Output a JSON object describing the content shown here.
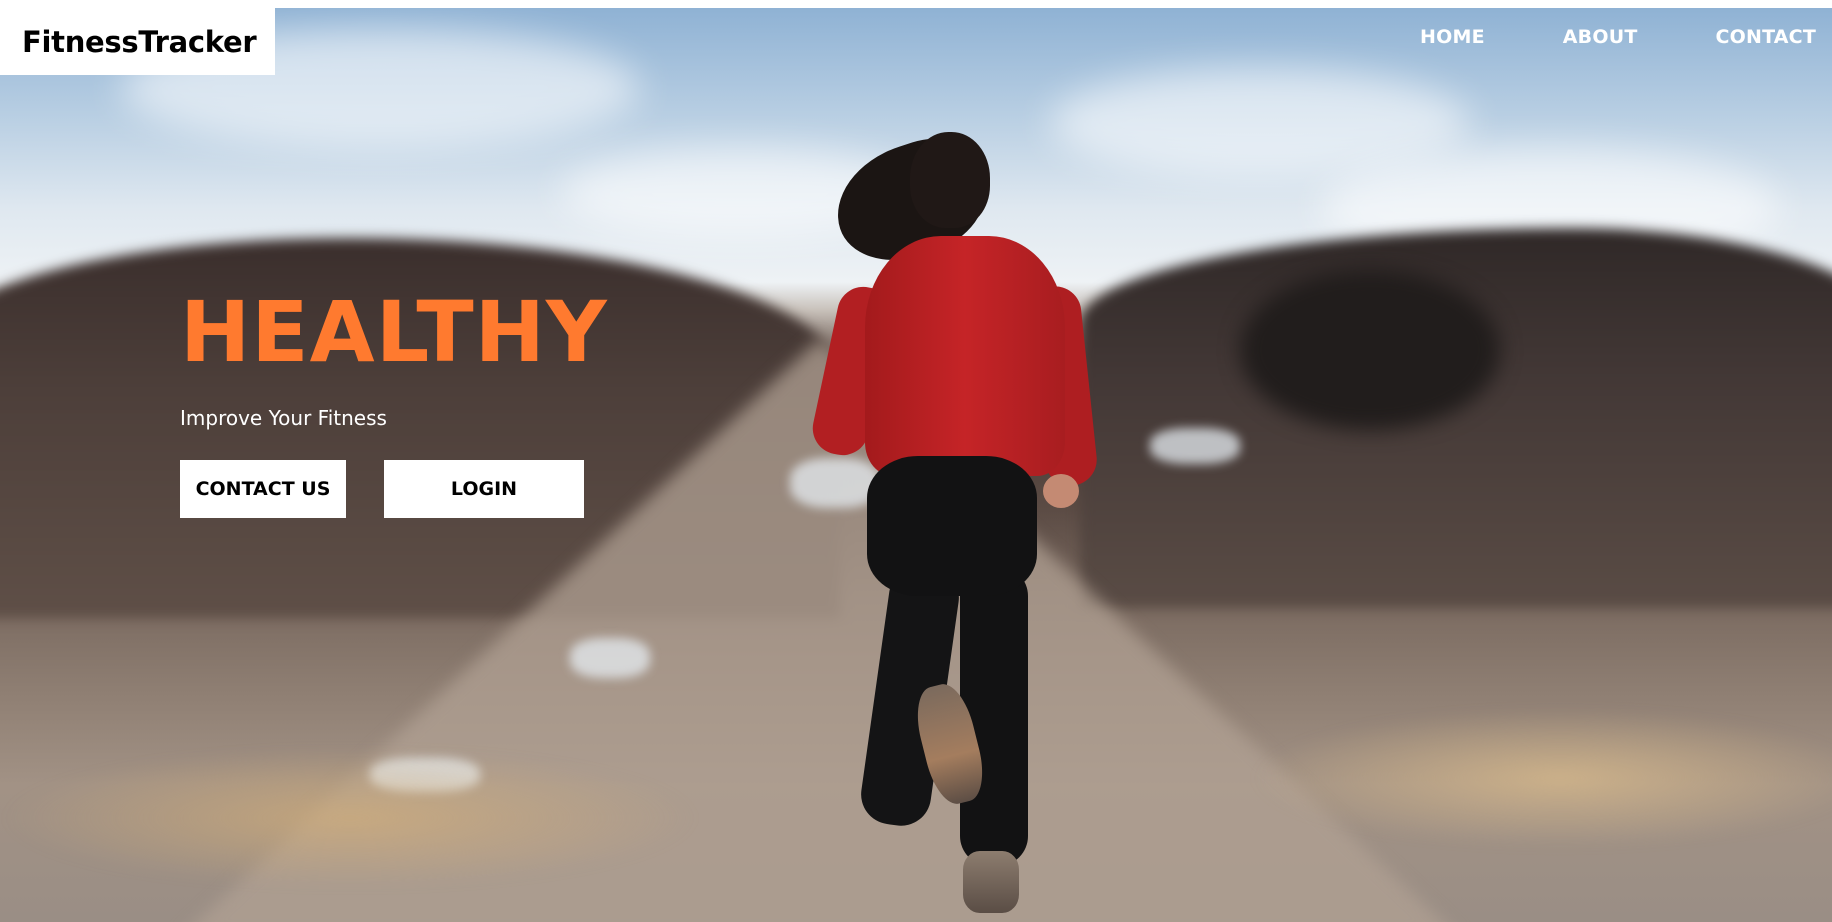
{
  "header": {
    "brand": "FitnessTracker",
    "nav": [
      {
        "label": "HOME"
      },
      {
        "label": "ABOUT"
      },
      {
        "label": "CONTACT"
      }
    ]
  },
  "hero": {
    "title": "HEALTHY",
    "subtitle": "Improve Your Fitness",
    "buttons": {
      "contact_label": "CONTACT US",
      "login_label": "LOGIN"
    },
    "background_image": "woman-running-on-road-photo"
  },
  "colors": {
    "accent": "#ff7a2f",
    "button_bg": "#ffffff",
    "button_text": "#000000",
    "nav_text": "#ffffff"
  }
}
